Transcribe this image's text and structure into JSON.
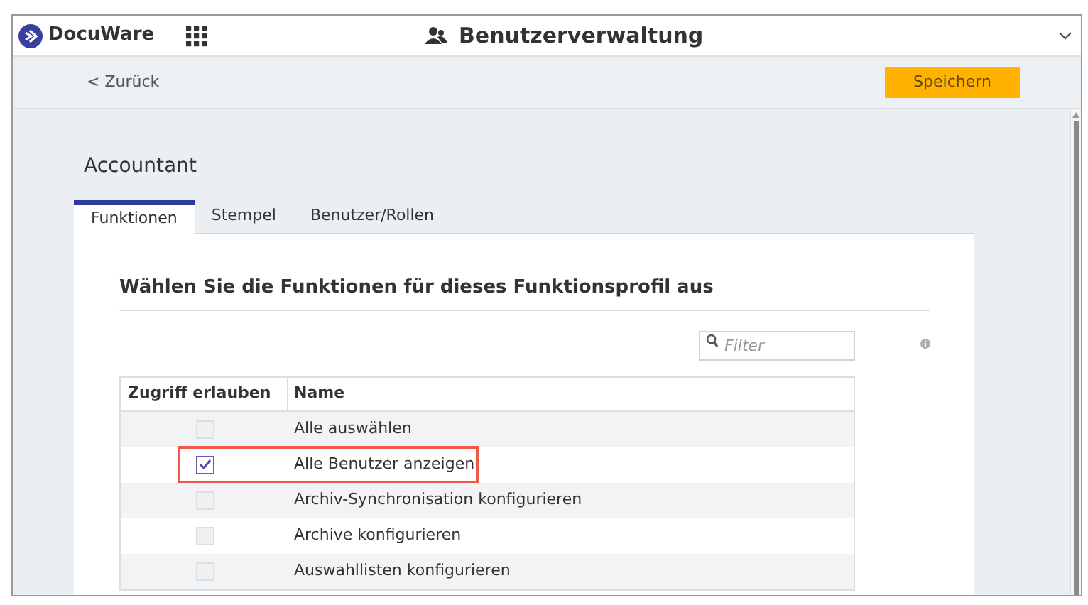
{
  "header": {
    "logo": "DocuWare",
    "title": "Benutzerverwaltung"
  },
  "toolbar": {
    "back": "< Zurück",
    "save": "Speichern"
  },
  "profile": {
    "title": "Accountant"
  },
  "tabs": [
    {
      "label": "Funktionen",
      "selected": true
    },
    {
      "label": "Stempel",
      "selected": false
    },
    {
      "label": "Benutzer/Rollen",
      "selected": false
    }
  ],
  "section": {
    "heading": "Wählen Sie die Funktionen für dieses Funktionsprofil aus",
    "filter": {
      "placeholder": "Filter"
    }
  },
  "table": {
    "columns": [
      "Zugriff erlauben",
      "Name"
    ],
    "rows": [
      {
        "name": "Alle auswählen",
        "checked": false,
        "highlighted": false
      },
      {
        "name": "Alle Benutzer anzeigen",
        "checked": true,
        "highlighted": true
      },
      {
        "name": "Archiv-Synchronisation konfigurieren",
        "checked": false,
        "highlighted": false
      },
      {
        "name": "Archive konfigurieren",
        "checked": false,
        "highlighted": false
      },
      {
        "name": "Auswahllisten konfigurieren",
        "checked": false,
        "highlighted": false
      }
    ]
  }
}
